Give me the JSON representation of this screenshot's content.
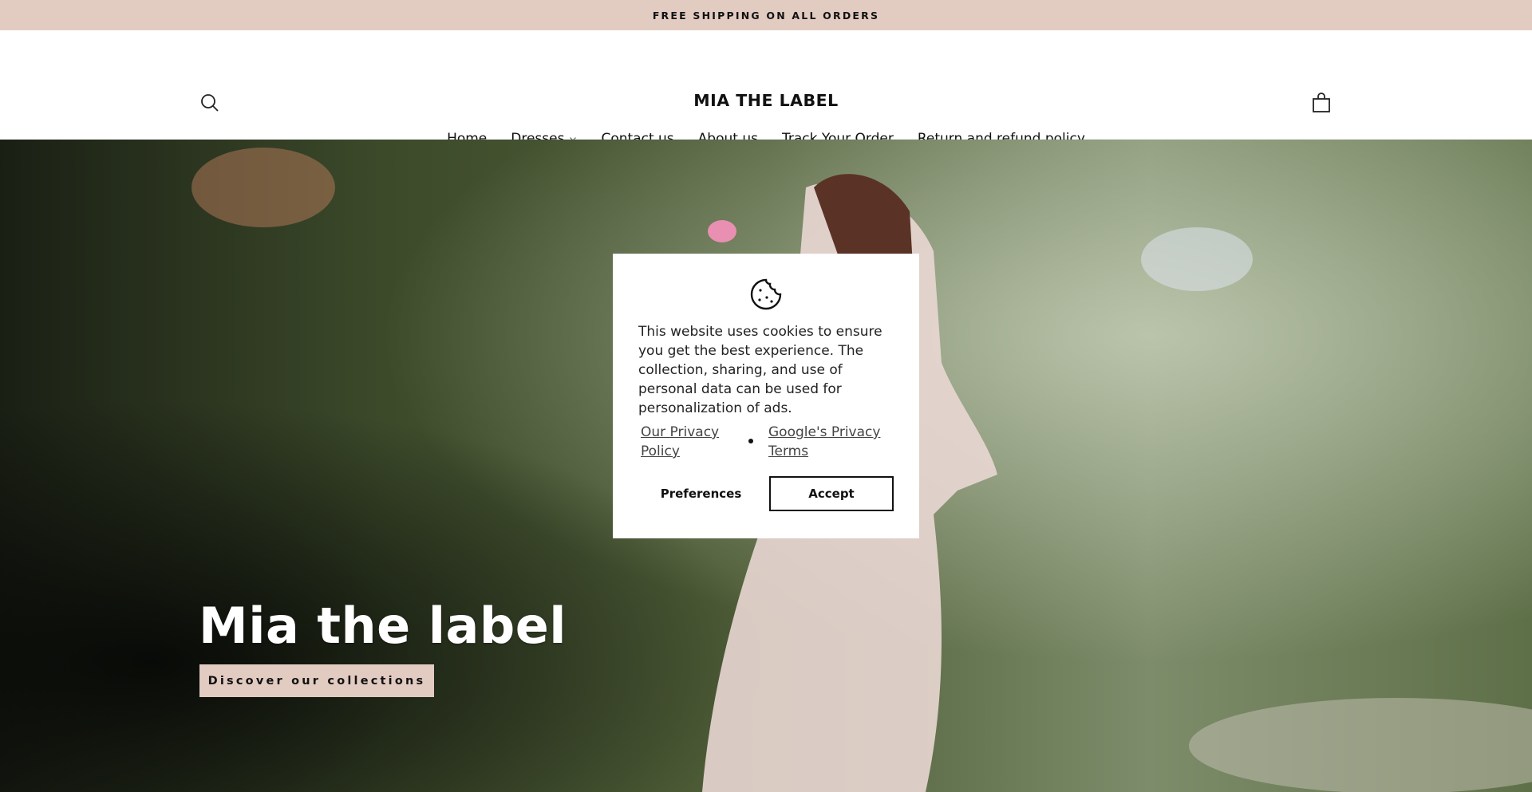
{
  "announcement": {
    "text": "FREE SHIPPING ON ALL ORDERS"
  },
  "header": {
    "logo": "MIA THE LABEL",
    "nav": [
      {
        "label": "Home"
      },
      {
        "label": "Dresses"
      },
      {
        "label": "Contact us"
      },
      {
        "label": "About us"
      },
      {
        "label": "Track Your Order"
      },
      {
        "label": "Return and refund policy"
      }
    ]
  },
  "hero": {
    "title": "Mia the label",
    "button_label": "Discover our collections"
  },
  "cookie_banner": {
    "icon": "cookie-icon",
    "message": "This website uses cookies to ensure you get the best experience. The collection, sharing, and use of personal data can be used for personalization of ads.",
    "link_privacy": "Our Privacy Policy",
    "link_google": "Google's Privacy Terms",
    "preferences_label": "Preferences",
    "accept_label": "Accept"
  },
  "colors": {
    "accent": "#e2cbc1",
    "text": "#111111"
  }
}
